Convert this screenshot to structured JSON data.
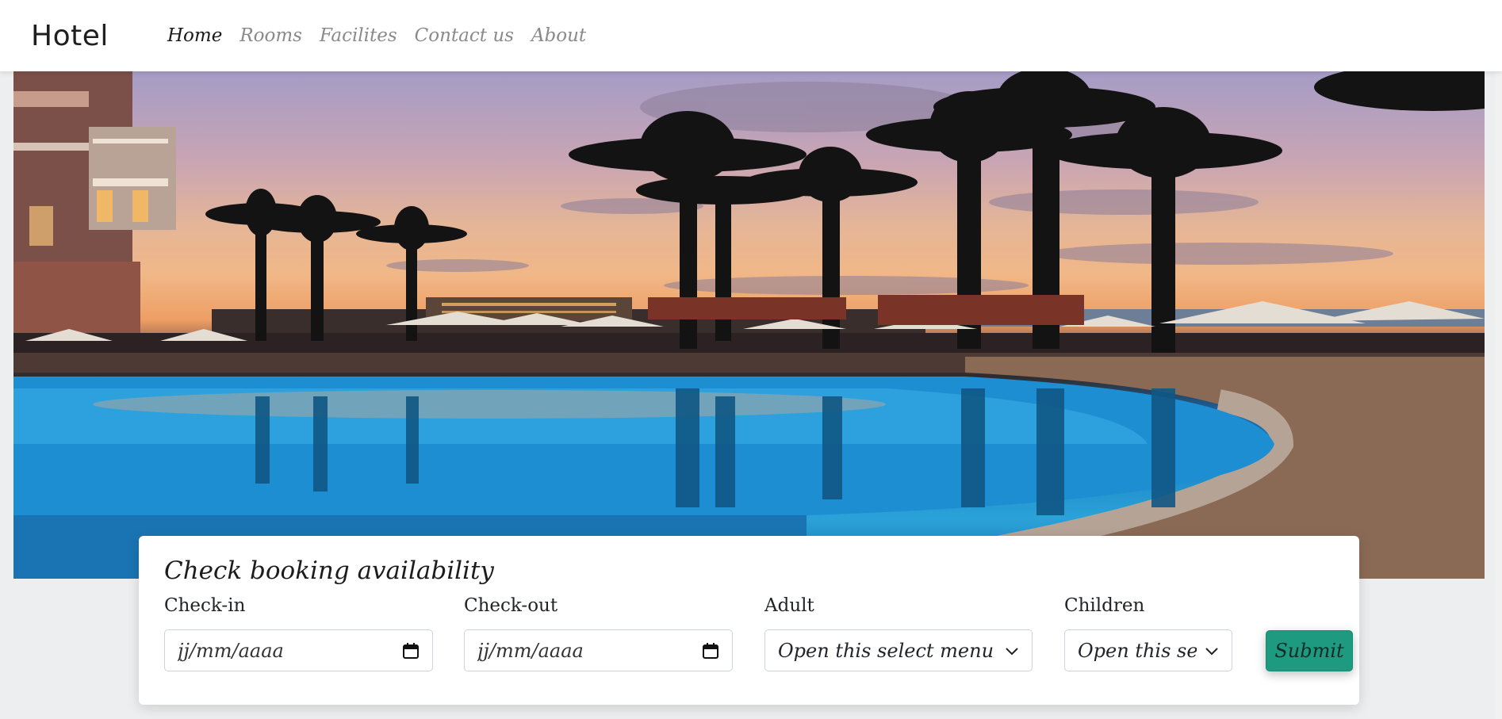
{
  "navbar": {
    "brand": "Hotel",
    "links": [
      {
        "label": "Home",
        "active": true
      },
      {
        "label": "Rooms",
        "active": false
      },
      {
        "label": "Facilites",
        "active": false
      },
      {
        "label": "Contact us",
        "active": false
      },
      {
        "label": "About",
        "active": false
      }
    ]
  },
  "hero": {
    "description_icon": "pool-sunset-image"
  },
  "booking": {
    "title": "Check booking availability",
    "checkin": {
      "label": "Check-in",
      "placeholder": "jj/mm/aaaa",
      "icon": "calendar-icon"
    },
    "checkout": {
      "label": "Check-out",
      "placeholder": "jj/mm/aaaa",
      "icon": "calendar-icon"
    },
    "adult": {
      "label": "Adult",
      "selected": "Open this select menu",
      "icon": "chevron-down-icon"
    },
    "children": {
      "label": "Children",
      "selected": "Open this select menu",
      "icon": "chevron-down-icon"
    },
    "submit_label": "Submit"
  },
  "colors": {
    "accent": "#1e9a80",
    "nav_active": "#1a1a1a",
    "nav_inactive": "#8a8a8a"
  }
}
